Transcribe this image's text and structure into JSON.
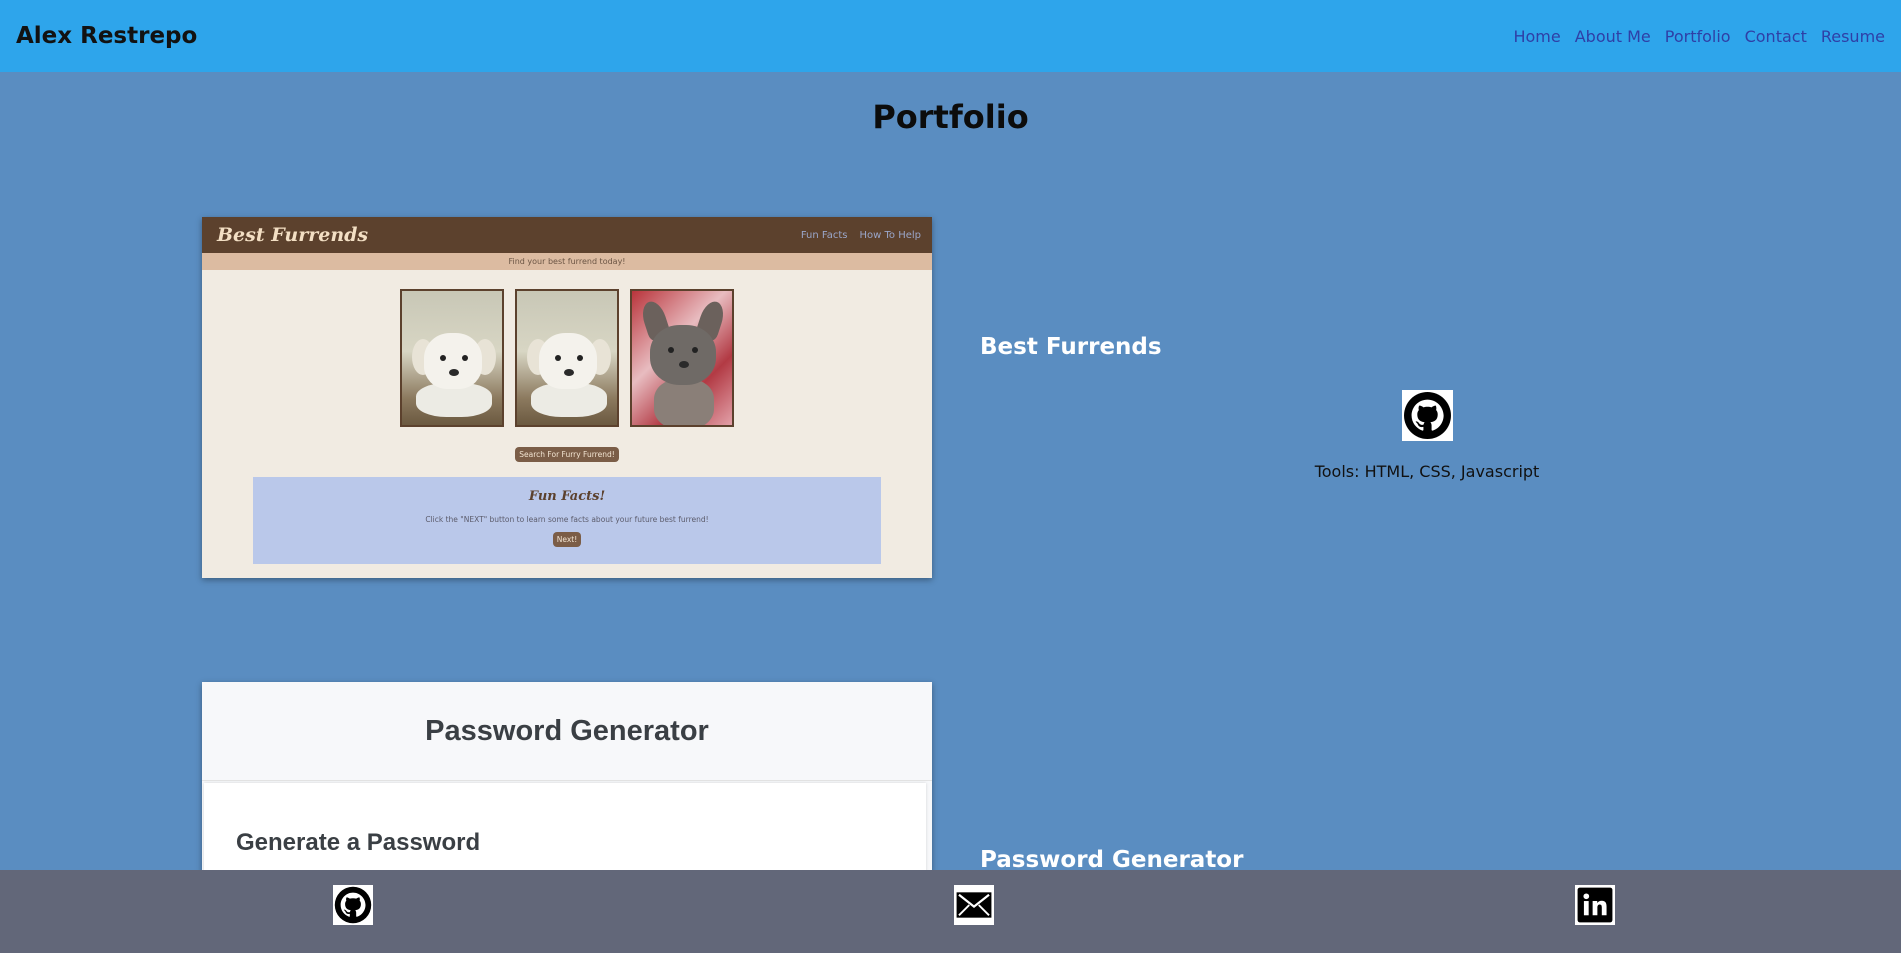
{
  "header": {
    "brand": "Alex Restrepo",
    "nav": [
      "Home",
      "About Me",
      "Portfolio",
      "Contact",
      "Resume"
    ]
  },
  "page_title": "Portfolio",
  "projects": [
    {
      "name": "Best Furrends",
      "tools": "Tools: HTML, CSS, Javascript",
      "icon": "github-icon",
      "screenshot": {
        "title": "Best Furrends",
        "nav": [
          "Fun Facts",
          "How To Help"
        ],
        "subtitle": "Find your best furrend today!",
        "search_button": "Search For Furry Furrend!",
        "facts_title": "Fun Facts!",
        "facts_text": "Click the \"NEXT\" button to learn some facts about your future best furrend!",
        "next_button": "Next!"
      }
    },
    {
      "name": "Password Generator",
      "screenshot": {
        "title": "Password Generator",
        "card_title": "Generate a Password"
      }
    }
  ],
  "footer": {
    "icons": [
      "github-icon",
      "mail-icon",
      "linkedin-icon"
    ]
  },
  "colors": {
    "navbar": "#2ea5eb",
    "page_bg": "#5a8dc1",
    "footer": "#626779",
    "nav_link": "#2f3fa6"
  }
}
